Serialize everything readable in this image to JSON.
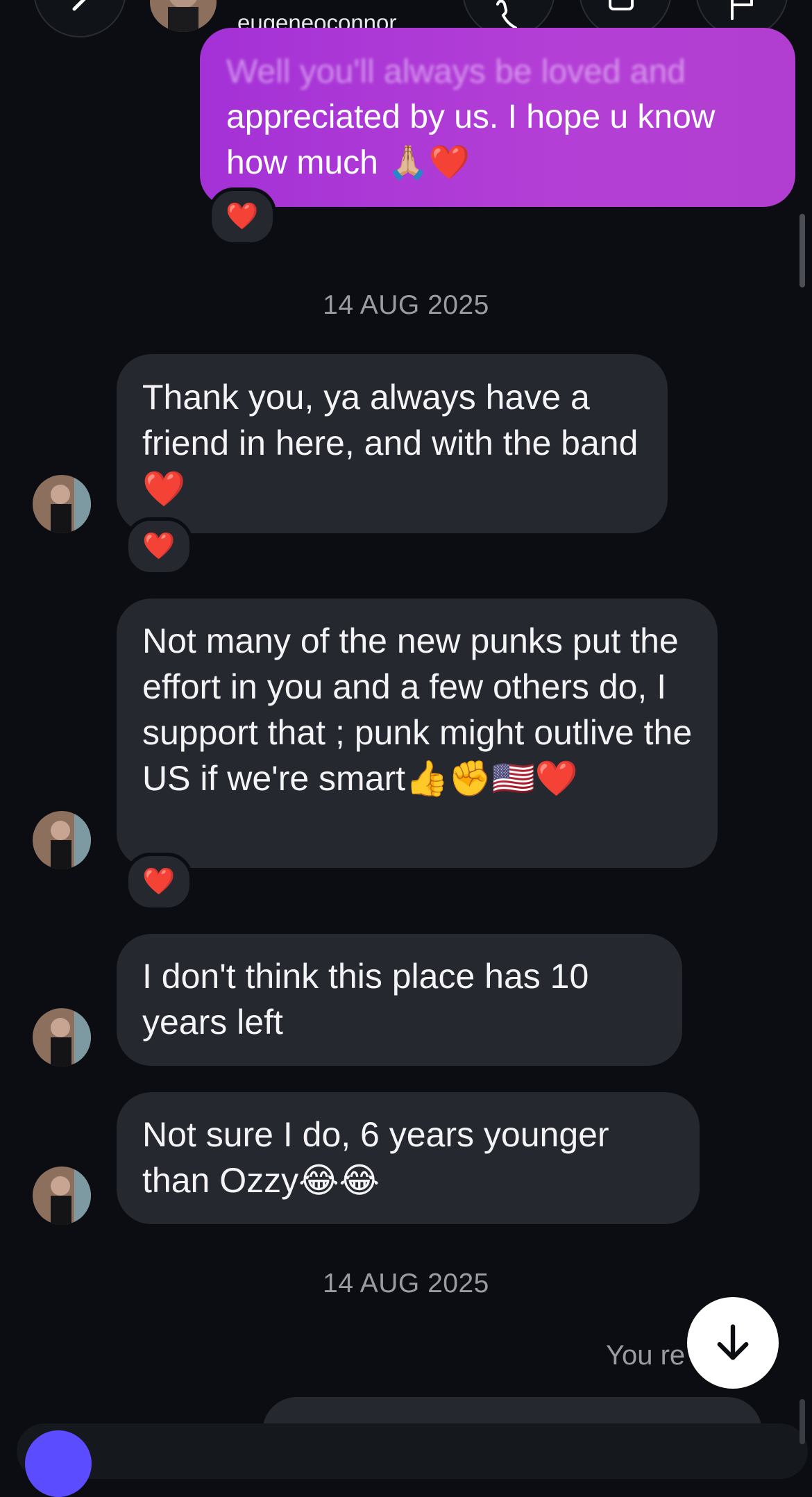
{
  "header": {
    "username": "eugeneoconnor...",
    "back_icon": "chevron-left-icon",
    "call_icon": "phone-icon",
    "video_icon": "video-camera-icon",
    "flag_icon": "flag-icon"
  },
  "outgoing_message": {
    "faded_line": "Well you'll always be loved and",
    "text": "appreciated by us. I hope u know how much 🙏🏼❤️",
    "reaction": "❤️"
  },
  "date_separators": [
    "14 AUG 2025",
    "14 AUG 2025"
  ],
  "incoming_messages": [
    {
      "text": "Thank you, ya always have a friend in here, and with the band❤️",
      "reaction": "❤️"
    },
    {
      "text": "Not many of the new punks put the effort in you and a few others do, I support that  ; punk might outlive the US if we're smart👍✊🇺🇸❤️",
      "reaction": "❤️"
    },
    {
      "text": "I don't think this place has 10 years left"
    },
    {
      "text": "Not sure I do, 6 years younger than Ozzy😂😂"
    }
  ],
  "footer": {
    "you_replied": "You re",
    "scroll_down_icon": "arrow-down-icon"
  },
  "colors": {
    "background": "#0b0d12",
    "incoming_bubble": "#25282e",
    "outgoing_bubble": "#b13ed0",
    "heart": "#e8102f"
  }
}
